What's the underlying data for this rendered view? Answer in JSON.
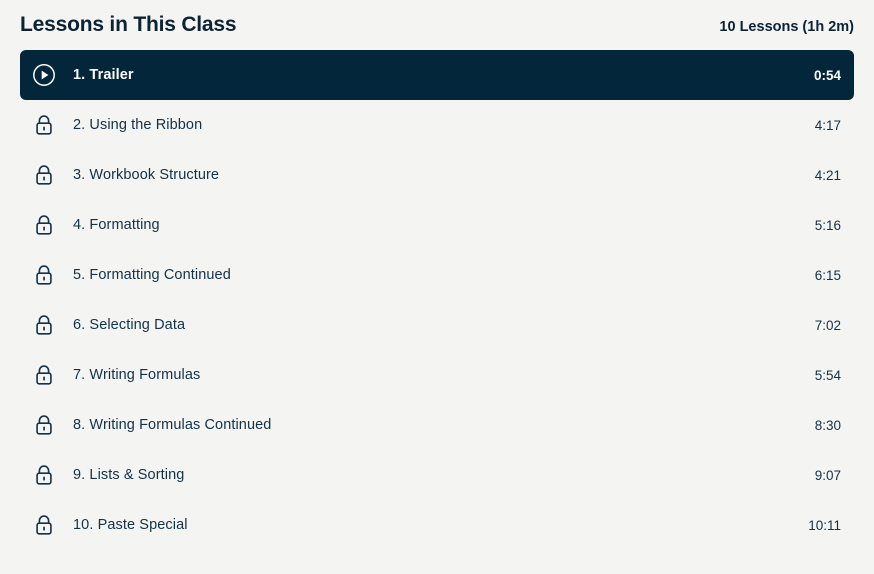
{
  "header": {
    "title": "Lessons in This Class",
    "count_label": "10 Lessons (1h 2m)"
  },
  "colors": {
    "page_background": "#f4f4f2",
    "active_row_background": "#04263a",
    "text_primary": "#0c2334",
    "text_row": "#12324a",
    "text_active": "#ffffff"
  },
  "lessons": [
    {
      "icon": "play-circle-icon",
      "title": "1. Trailer",
      "duration": "0:54",
      "state": "active"
    },
    {
      "icon": "lock-icon",
      "title": "2. Using the Ribbon",
      "duration": "4:17",
      "state": "locked"
    },
    {
      "icon": "lock-icon",
      "title": "3. Workbook Structure",
      "duration": "4:21",
      "state": "locked"
    },
    {
      "icon": "lock-icon",
      "title": "4. Formatting",
      "duration": "5:16",
      "state": "locked"
    },
    {
      "icon": "lock-icon",
      "title": "5. Formatting Continued",
      "duration": "6:15",
      "state": "locked"
    },
    {
      "icon": "lock-icon",
      "title": "6. Selecting Data",
      "duration": "7:02",
      "state": "locked"
    },
    {
      "icon": "lock-icon",
      "title": "7. Writing Formulas",
      "duration": "5:54",
      "state": "locked"
    },
    {
      "icon": "lock-icon",
      "title": "8. Writing Formulas Continued",
      "duration": "8:30",
      "state": "locked"
    },
    {
      "icon": "lock-icon",
      "title": "9. Lists & Sorting",
      "duration": "9:07",
      "state": "locked"
    },
    {
      "icon": "lock-icon",
      "title": "10. Paste Special",
      "duration": "10:11",
      "state": "locked"
    }
  ]
}
